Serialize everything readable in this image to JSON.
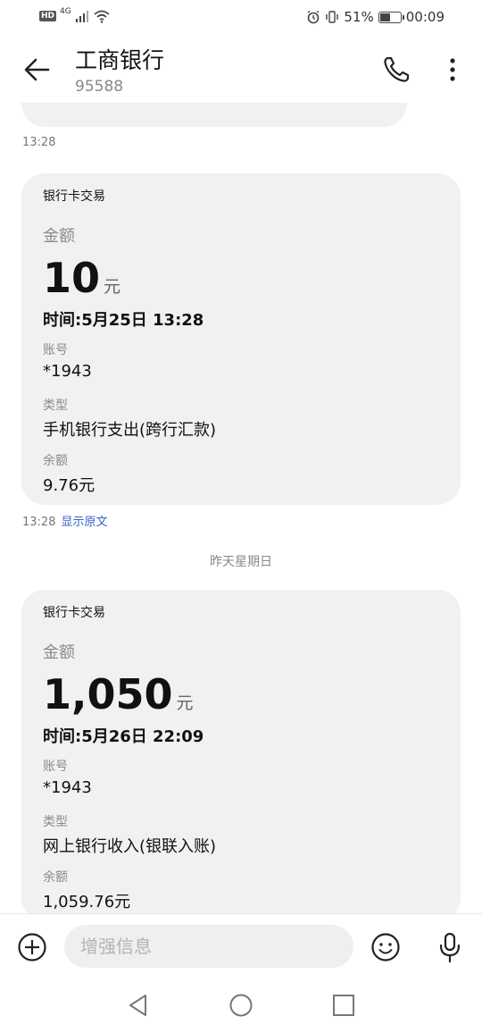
{
  "status_bar": {
    "hd": "HD",
    "network": "4G",
    "battery_percent": "51%",
    "battery_level": 0.51,
    "time": "00:09"
  },
  "header": {
    "contact_name": "工商银行",
    "contact_number": "95588",
    "icons": [
      "arrow-left-icon",
      "phone-icon",
      "more-vertical-icon"
    ]
  },
  "thread": {
    "messages": [
      {
        "time": "13:28",
        "title": "银行卡交易",
        "amount_label": "金额",
        "amount": "10",
        "unit": "元",
        "time_line": "时间:5月25日 13:28",
        "account_label": "账号",
        "account": "*1943",
        "type_label": "类型",
        "type": "手机银行支出(跨行汇款)",
        "balance_label": "余额",
        "balance": "9.76元",
        "footer_time": "13:28",
        "show_original": "显示原文"
      },
      {
        "title": "银行卡交易",
        "amount_label": "金额",
        "amount": "1,050",
        "unit": "元",
        "time_line": "时间:5月26日 22:09",
        "account_label": "账号",
        "account": "*1943",
        "type_label": "类型",
        "type": "网上银行收入(银联入账)",
        "balance_label": "余额",
        "balance": "1,059.76元"
      }
    ],
    "date_separator": "昨天星期日"
  },
  "compose": {
    "placeholder": "增强信息",
    "icons": [
      "add-circle-icon",
      "emoji-icon",
      "microphone-icon"
    ]
  },
  "nav": {
    "icons": [
      "nav-back-icon",
      "nav-home-icon",
      "nav-recent-icon"
    ]
  },
  "colors": {
    "bubble": "#f1f1f1",
    "link": "#3a5fcd",
    "muted": "#8a8a8a"
  }
}
